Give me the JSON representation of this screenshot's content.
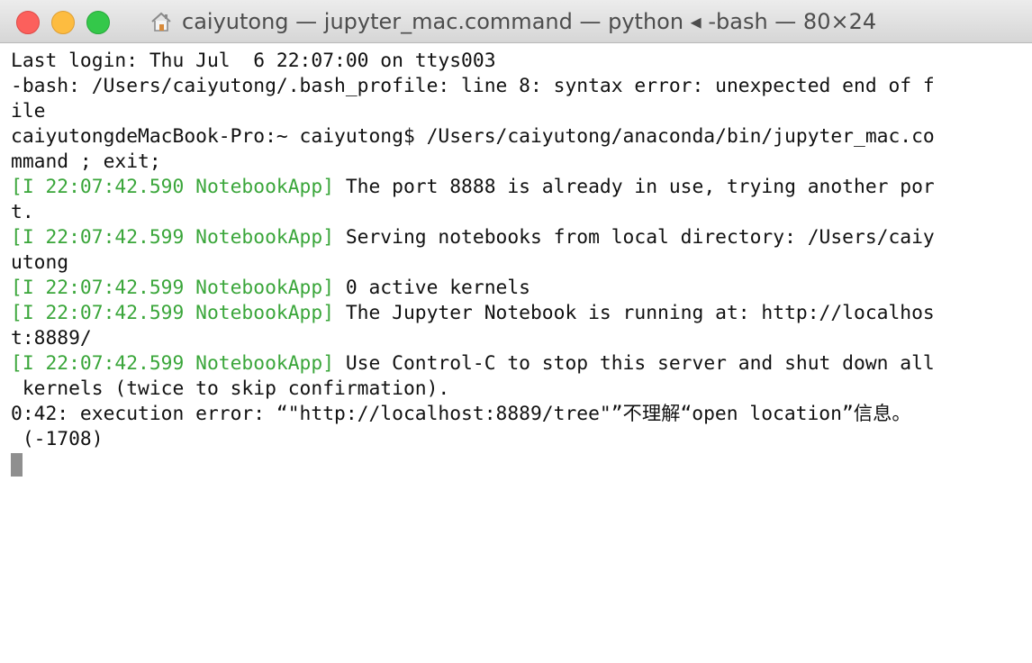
{
  "window": {
    "title": "caiyutong — jupyter_mac.command — python ◂ -bash — 80×24",
    "home_icon": "home-icon",
    "buttons": [
      "close",
      "minimize",
      "zoom"
    ],
    "colors": {
      "close": "#fc605c",
      "minimize": "#fdbc40",
      "zoom": "#34c84a"
    }
  },
  "terminal": {
    "log_color": "#3aa63a",
    "lines": [
      {
        "text": "Last login: Thu Jul  6 22:07:00 on ttys003"
      },
      {
        "text": "-bash: /Users/caiyutong/.bash_profile: line 8: syntax error: unexpected end of f"
      },
      {
        "text": "ile"
      },
      {
        "text": "caiyutongdeMacBook-Pro:~ caiyutong$ /Users/caiyutong/anaconda/bin/jupyter_mac.co"
      },
      {
        "text": "mmand ; exit;"
      },
      {
        "prefix": "[I 22:07:42.590 NotebookApp]",
        "text": " The port 8888 is already in use, trying another por"
      },
      {
        "text": "t."
      },
      {
        "prefix": "[I 22:07:42.599 NotebookApp]",
        "text": " Serving notebooks from local directory: /Users/caiy"
      },
      {
        "text": "utong"
      },
      {
        "prefix": "[I 22:07:42.599 NotebookApp]",
        "text": " 0 active kernels"
      },
      {
        "prefix": "[I 22:07:42.599 NotebookApp]",
        "text": " The Jupyter Notebook is running at: http://localhos"
      },
      {
        "text": "t:8889/"
      },
      {
        "prefix": "[I 22:07:42.599 NotebookApp]",
        "text": " Use Control-C to stop this server and shut down all"
      },
      {
        "text": " kernels (twice to skip confirmation)."
      },
      {
        "text": "0:42: execution error: “\"http://localhost:8889/tree\"”不理解“open location”信息。"
      },
      {
        "text": " (-1708)"
      }
    ]
  }
}
